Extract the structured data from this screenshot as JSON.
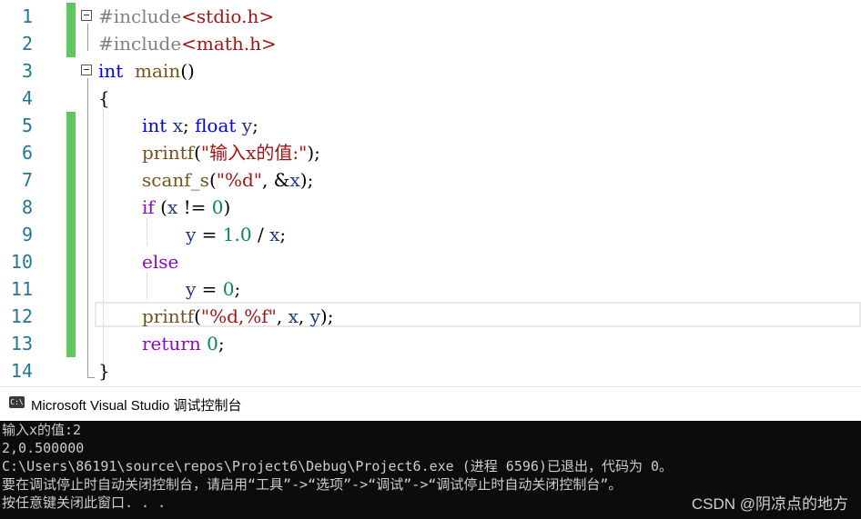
{
  "editor": {
    "colors": {
      "keyword": "#0000ff",
      "string": "#a31515",
      "preprocessor": "#808080",
      "line_number": "#237893",
      "change_bar": "#5ec85e"
    },
    "lines": [
      {
        "no": "1",
        "parts": [
          [
            "pp",
            "#include"
          ],
          [
            "str",
            "<stdio.h>"
          ]
        ]
      },
      {
        "no": "2",
        "parts": [
          [
            "pp",
            "#include"
          ],
          [
            "str",
            "<math.h>"
          ]
        ]
      },
      {
        "no": "3",
        "parts": [
          [
            "kw",
            "int"
          ],
          [
            "",
            "  "
          ],
          [
            "fn",
            "main"
          ],
          [
            "",
            "()"
          ]
        ]
      },
      {
        "no": "4",
        "parts": [
          [
            "",
            "{"
          ]
        ]
      },
      {
        "no": "5",
        "parts": [
          [
            "kw",
            "int"
          ],
          [
            "",
            " "
          ],
          [
            "var",
            "x"
          ],
          [
            "",
            "; "
          ],
          [
            "kw",
            "float"
          ],
          [
            "",
            " "
          ],
          [
            "var",
            "y"
          ],
          [
            "",
            ";"
          ]
        ]
      },
      {
        "no": "6",
        "parts": [
          [
            "fn",
            "printf"
          ],
          [
            "",
            "("
          ],
          [
            "str",
            "\"输入x的值:\""
          ],
          [
            "",
            ");"
          ]
        ]
      },
      {
        "no": "7",
        "parts": [
          [
            "fn",
            "scanf_s"
          ],
          [
            "",
            "("
          ],
          [
            "str",
            "\"%d\""
          ],
          [
            "",
            ", &"
          ],
          [
            "var",
            "x"
          ],
          [
            "",
            ");"
          ]
        ]
      },
      {
        "no": "8",
        "parts": [
          [
            "ctl",
            "if"
          ],
          [
            "",
            " ("
          ],
          [
            "var",
            "x"
          ],
          [
            "",
            " != "
          ],
          [
            "num",
            "0"
          ],
          [
            "",
            ")"
          ]
        ]
      },
      {
        "no": "9",
        "parts": [
          [
            "var",
            "y"
          ],
          [
            "",
            " = "
          ],
          [
            "num",
            "1.0"
          ],
          [
            "",
            " / "
          ],
          [
            "var",
            "x"
          ],
          [
            "",
            ";"
          ]
        ]
      },
      {
        "no": "10",
        "parts": [
          [
            "ctl",
            "else"
          ]
        ]
      },
      {
        "no": "11",
        "parts": [
          [
            "var",
            "y"
          ],
          [
            "",
            " = "
          ],
          [
            "num",
            "0"
          ],
          [
            "",
            ";"
          ]
        ]
      },
      {
        "no": "12",
        "parts": [
          [
            "fn",
            "printf"
          ],
          [
            "",
            "("
          ],
          [
            "str",
            "\"%d,%f\""
          ],
          [
            "",
            ", "
          ],
          [
            "var",
            "x"
          ],
          [
            "",
            ", "
          ],
          [
            "var",
            "y"
          ],
          [
            "",
            ");"
          ]
        ]
      },
      {
        "no": "13",
        "parts": [
          [
            "ctl",
            "return"
          ],
          [
            "",
            " "
          ],
          [
            "num",
            "0"
          ],
          [
            "",
            ";"
          ]
        ]
      },
      {
        "no": "14",
        "parts": [
          [
            "",
            "}"
          ]
        ]
      }
    ]
  },
  "console": {
    "title": "Microsoft Visual Studio 调试控制台",
    "icon": "console-app-icon",
    "icon_text": "C:\\",
    "lines": [
      "输入x的值:2",
      "2,0.500000",
      "C:\\Users\\86191\\source\\repos\\Project6\\Debug\\Project6.exe (进程 6596)已退出，代码为 0。",
      "要在调试停止时自动关闭控制台，请启用“工具”->“选项”->“调试”->“调试停止时自动关闭控制台”。",
      "按任意键关闭此窗口. . ."
    ]
  },
  "watermark": "CSDN @阴凉点的地方"
}
